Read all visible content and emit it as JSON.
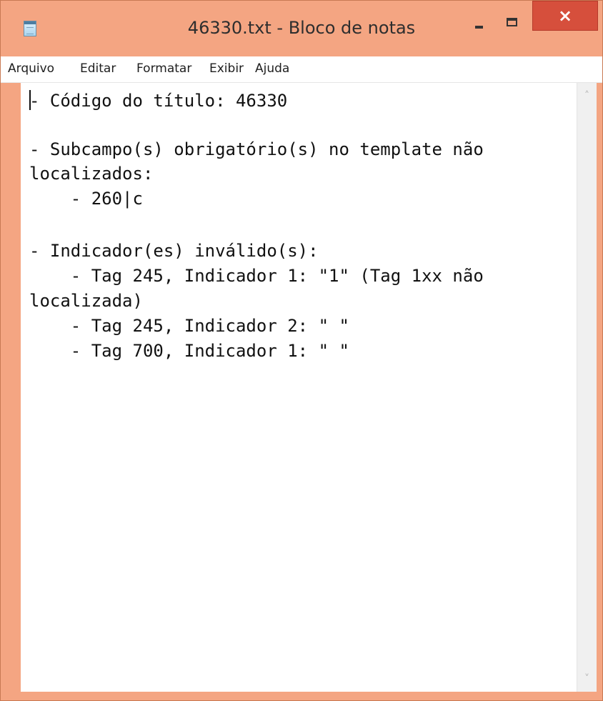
{
  "window": {
    "title": "46330.txt - Bloco de notas",
    "close_symbol": "×",
    "icon": "notepad-icon",
    "colors": {
      "frame": "#f4a582",
      "close_button": "#d64f3c"
    }
  },
  "menu": {
    "items": [
      "Arquivo",
      "Editar",
      "Formatar",
      "Exibir",
      "Ajuda"
    ]
  },
  "editor": {
    "lines": [
      "- Código do título: 46330",
      "",
      "- Subcampo(s) obrigatório(s) no template não",
      "localizados:",
      "    - 260|c",
      "",
      "- Indicador(es) inválido(s):",
      "    - Tag 245, Indicador 1: \"1\" (Tag 1xx não",
      "localizada)",
      "    - Tag 245, Indicador 2: \" \"",
      "    - Tag 700, Indicador 1: \" \""
    ]
  },
  "scrollbar": {
    "up_symbol": "˄",
    "down_symbol": "˅"
  }
}
